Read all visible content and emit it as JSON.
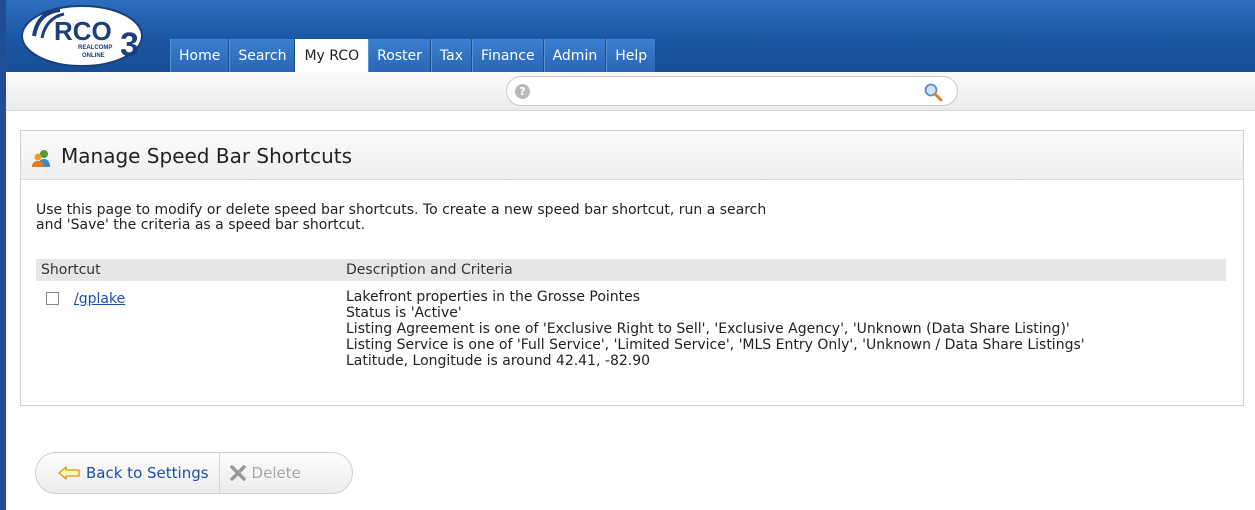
{
  "logo": {
    "main": "RCO",
    "superscript": "3",
    "tagline1": "REALCOMP",
    "tagline2": "ONLINE"
  },
  "nav": {
    "tabs": [
      {
        "label": "Home",
        "active": false
      },
      {
        "label": "Search",
        "active": false
      },
      {
        "label": "My RCO",
        "active": true
      },
      {
        "label": "Roster",
        "active": false
      },
      {
        "label": "Tax",
        "active": false
      },
      {
        "label": "Finance",
        "active": false
      },
      {
        "label": "Admin",
        "active": false
      },
      {
        "label": "Help",
        "active": false
      }
    ]
  },
  "speedbar": {
    "value": "",
    "help_icon": "help-icon",
    "search_icon": "magnifier-icon",
    "help_glyph": "?"
  },
  "panel": {
    "title": "Manage Speed Bar Shortcuts",
    "intro_line1": "Use this page to modify or delete speed bar shortcuts. To create a new speed bar shortcut, run a search",
    "intro_line2": "and 'Save' the criteria as a speed bar shortcut.",
    "columns": [
      "Shortcut",
      "Description and Criteria"
    ],
    "rows": [
      {
        "shortcut": "/gplake",
        "checked": false,
        "criteria": [
          "Lakefront properties in the Grosse Pointes",
          "Status is 'Active'",
          "Listing Agreement is one of 'Exclusive Right to Sell', 'Exclusive Agency', 'Unknown (Data Share Listing)'",
          "Listing Service is one of 'Full Service', 'Limited Service', 'MLS Entry Only', 'Unknown / Data Share Listings'",
          "Latitude, Longitude is around 42.41, -82.90"
        ]
      }
    ]
  },
  "buttons": {
    "back_label": "Back to Settings",
    "delete_label": "Delete"
  },
  "colors": {
    "nav_blue": "#1d5aa6",
    "link": "#1a4fae",
    "accent_orange": "#f0a020"
  }
}
